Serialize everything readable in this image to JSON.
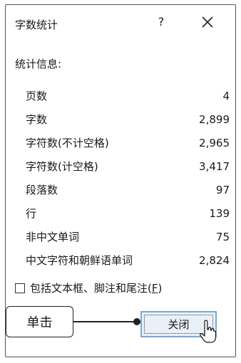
{
  "dialog": {
    "title": "字数统计",
    "help_label": "?",
    "close_icon": "close-x-icon"
  },
  "stats_heading": "统计信息:",
  "stats": [
    {
      "label": "页数",
      "value": "4"
    },
    {
      "label": "字数",
      "value": "2,899"
    },
    {
      "label": "字符数(不计空格)",
      "value": "2,965"
    },
    {
      "label": "字符数(计空格)",
      "value": "3,417"
    },
    {
      "label": "段落数",
      "value": "97"
    },
    {
      "label": "行",
      "value": "139"
    },
    {
      "label": "非中文单词",
      "value": "75"
    },
    {
      "label": "中文字符和朝鲜语单词",
      "value": "2,824"
    }
  ],
  "checkbox": {
    "label_main": "包括文本框、脚注和尾注(",
    "label_key": "F",
    "label_end": ")",
    "checked": false
  },
  "close_button": {
    "label": "关闭"
  },
  "callout": {
    "label": "单击"
  },
  "colors": {
    "button_border": "#7aa8d6",
    "button_fill": "#e9f0f8",
    "dialog_border": "#555555"
  }
}
